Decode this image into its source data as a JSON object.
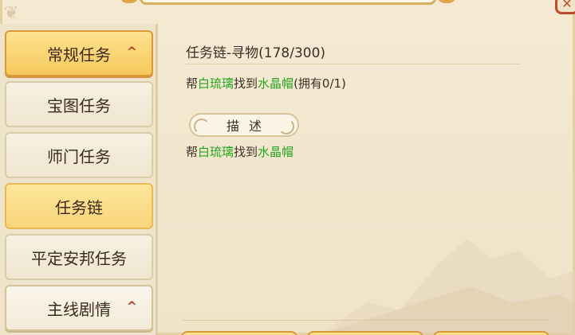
{
  "window": {
    "close_label": "✕"
  },
  "sidebar": {
    "items": [
      {
        "label": "常规任务",
        "type": "header",
        "chevron": "^"
      },
      {
        "label": "宝图任务",
        "type": "item"
      },
      {
        "label": "师门任务",
        "type": "item"
      },
      {
        "label": "任务链",
        "type": "active"
      },
      {
        "label": "平定安邦任务",
        "type": "item"
      },
      {
        "label": "主线剧情",
        "type": "header-alt",
        "chevron": "^"
      }
    ]
  },
  "main": {
    "task_title": "任务链-寻物(178/300)",
    "goal": {
      "prefix": "帮",
      "npc": "白琉璃",
      "middle": "找到",
      "item": "水晶帽",
      "suffix": "(拥有0/1)"
    },
    "description_label": "描述",
    "description": {
      "prefix": "帮",
      "npc": "白琉璃",
      "middle": "找到",
      "item": "水晶帽"
    }
  },
  "colors": {
    "highlight_green": "#23a51f",
    "header_gold": "#f6c85c",
    "close_red": "#c24a2c"
  }
}
